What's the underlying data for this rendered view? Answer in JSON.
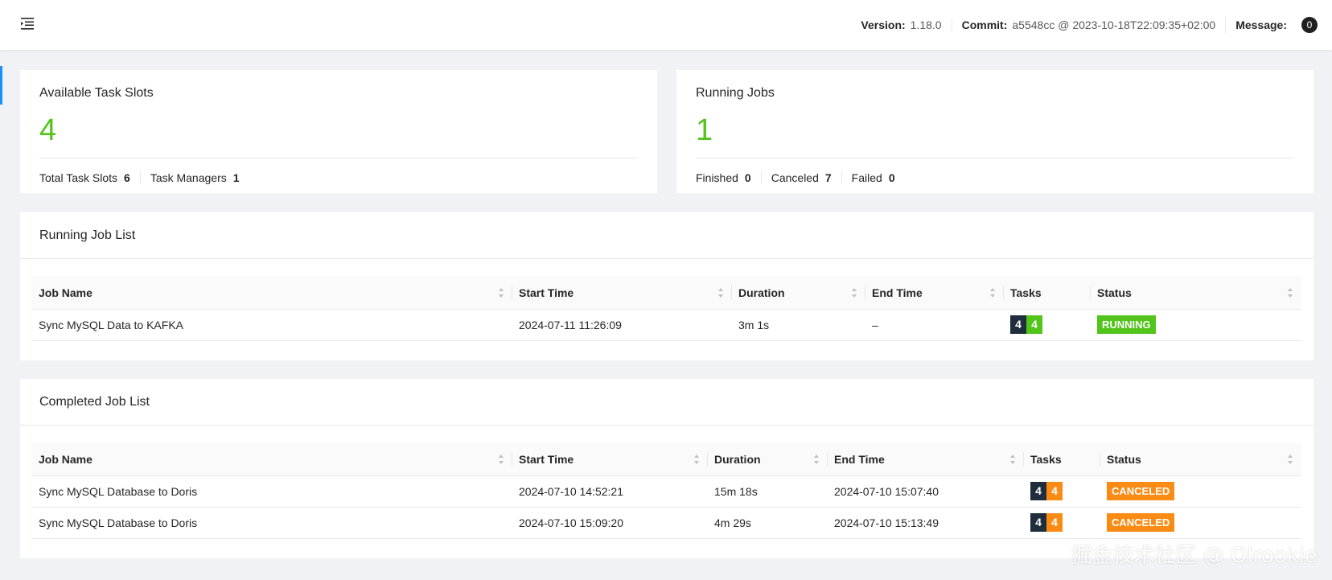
{
  "header": {
    "version_label": "Version:",
    "version_value": "1.18.0",
    "commit_label": "Commit:",
    "commit_value": "a5548cc @ 2023-10-18T22:09:35+02:00",
    "message_label": "Message:",
    "message_count": "0"
  },
  "task_slots": {
    "title": "Available Task Slots",
    "value": "4",
    "total_label": "Total Task Slots",
    "total_value": "6",
    "managers_label": "Task Managers",
    "managers_value": "1"
  },
  "running_jobs_summary": {
    "title": "Running Jobs",
    "value": "1",
    "finished_label": "Finished",
    "finished_value": "0",
    "canceled_label": "Canceled",
    "canceled_value": "7",
    "failed_label": "Failed",
    "failed_value": "0"
  },
  "running_list": {
    "title": "Running Job List",
    "columns": [
      "Job Name",
      "Start Time",
      "Duration",
      "End Time",
      "Tasks",
      "Status"
    ],
    "rows": [
      {
        "name": "Sync MySQL Data to KAFKA",
        "start": "2024-07-11 11:26:09",
        "duration": "3m 1s",
        "end": "–",
        "tasks_total": "4",
        "tasks_state": "4",
        "status": "RUNNING"
      }
    ]
  },
  "completed_list": {
    "title": "Completed Job List",
    "columns": [
      "Job Name",
      "Start Time",
      "Duration",
      "End Time",
      "Tasks",
      "Status"
    ],
    "rows": [
      {
        "name": "Sync MySQL Database to Doris",
        "start": "2024-07-10 14:52:21",
        "duration": "15m 18s",
        "end": "2024-07-10 15:07:40",
        "tasks_total": "4",
        "tasks_state": "4",
        "status": "CANCELED"
      },
      {
        "name": "Sync MySQL Database to Doris",
        "start": "2024-07-10 15:09:20",
        "duration": "4m 29s",
        "end": "2024-07-10 15:13:49",
        "tasks_total": "4",
        "tasks_state": "4",
        "status": "CANCELED"
      }
    ]
  },
  "watermark": "掘金技术社区 @ Olrookie",
  "colors": {
    "success": "#52c41a",
    "warning": "#fa8c16",
    "dark": "#1f2d3d"
  }
}
